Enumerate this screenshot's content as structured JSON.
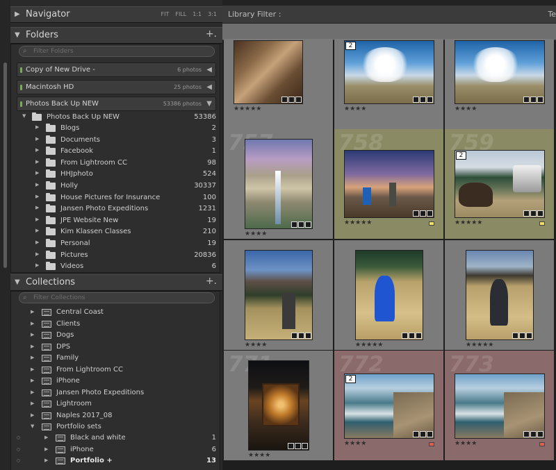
{
  "navigator": {
    "title": "Navigator",
    "options": [
      "FIT",
      "FILL",
      "1:1",
      "3:1"
    ]
  },
  "folders": {
    "title": "Folders",
    "add": "+.",
    "filter_placeholder": "Filter Folders",
    "volumes": [
      {
        "name": "Copy of New Drive -",
        "info": "6 photos"
      },
      {
        "name": "Macintosh HD",
        "info": "25 photos"
      },
      {
        "name": "Photos Back Up NEW",
        "info": "53386 photos"
      }
    ],
    "root": {
      "name": "Photos Back Up NEW",
      "count": "53386"
    },
    "items": [
      {
        "name": "Blogs",
        "count": "2"
      },
      {
        "name": "Documents",
        "count": "3"
      },
      {
        "name": "Facebook",
        "count": "1"
      },
      {
        "name": "From Lightroom CC",
        "count": "98"
      },
      {
        "name": "HHJphoto",
        "count": "524"
      },
      {
        "name": "Holly",
        "count": "30337"
      },
      {
        "name": "House Pictures for Insurance",
        "count": "100"
      },
      {
        "name": "Jansen Photo Expeditions",
        "count": "1231"
      },
      {
        "name": "JPE Website New",
        "count": "19"
      },
      {
        "name": "Kim Klassen Classes",
        "count": "210"
      },
      {
        "name": "Personal",
        "count": "19"
      },
      {
        "name": "Pictures",
        "count": "20836"
      },
      {
        "name": "Videos",
        "count": "6"
      }
    ]
  },
  "collections": {
    "title": "Collections",
    "add": "+.",
    "filter_placeholder": "Filter Collections",
    "items": [
      {
        "name": "Central Coast"
      },
      {
        "name": "Clients"
      },
      {
        "name": "Dogs"
      },
      {
        "name": "DPS"
      },
      {
        "name": "Family"
      },
      {
        "name": "From Lightroom CC"
      },
      {
        "name": "iPhone"
      },
      {
        "name": "Jansen Photo Expeditions"
      },
      {
        "name": "Lightroom"
      },
      {
        "name": "Naples 2017_08"
      },
      {
        "name": "Portfolio sets"
      }
    ],
    "sub_items": [
      {
        "name": "Black and white",
        "count": "1"
      },
      {
        "name": "iPhone",
        "count": "6"
      },
      {
        "name": "Portfolio +",
        "count": "13"
      }
    ]
  },
  "library_filter": {
    "label": "Library Filter :",
    "right": "Te"
  },
  "grid": {
    "rows": [
      [
        {
          "num": "",
          "stars": "★★★★★",
          "stack": ""
        },
        {
          "num": "",
          "stars": "★★★★",
          "stack": "2"
        },
        {
          "num": "",
          "stars": "★★★★",
          "stack": ""
        }
      ],
      [
        {
          "num": "757",
          "stars": "★★★★",
          "stack": ""
        },
        {
          "num": "758",
          "stars": "★★★★★",
          "stack": ""
        },
        {
          "num": "759",
          "stars": "★★★★★",
          "stack": "2"
        }
      ],
      [
        {
          "num": "",
          "stars": "★★★★",
          "stack": ""
        },
        {
          "num": "",
          "stars": "★★★★★",
          "stack": ""
        },
        {
          "num": "",
          "stars": "★★★★★",
          "stack": ""
        }
      ],
      [
        {
          "num": "771",
          "stars": "★★★★",
          "stack": ""
        },
        {
          "num": "772",
          "stars": "★★★★",
          "stack": "2"
        },
        {
          "num": "773",
          "stars": "★★★★",
          "stack": ""
        }
      ]
    ]
  },
  "colors": {
    "cell_default": "#7b7b7b",
    "cell_yellow": "#8a8a64",
    "cell_red": "#8a6a6a",
    "label_yellow": "#f0e060",
    "label_red": "#e06050"
  }
}
